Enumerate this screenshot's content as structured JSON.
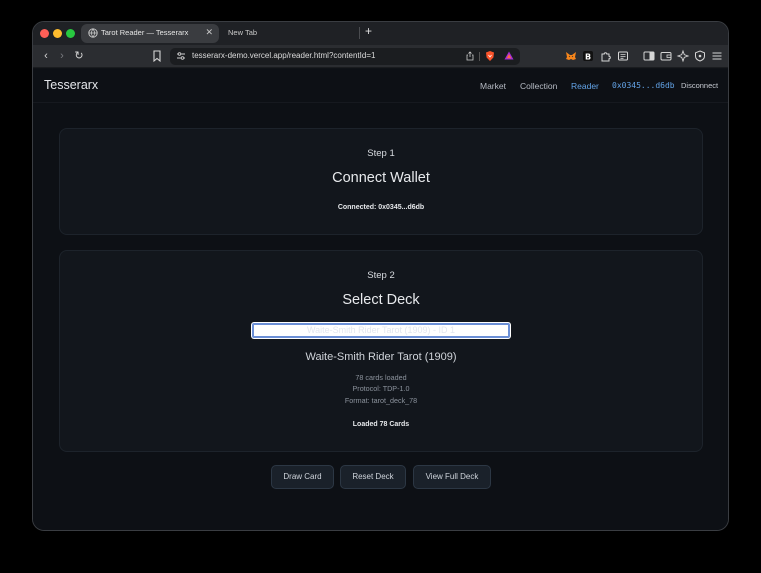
{
  "browser": {
    "active_tab_title": "Tarot Reader — Tesserarx",
    "new_tab_title": "New Tab",
    "url": "tesserarx-demo.vercel.app/reader.html?contentId=1"
  },
  "app": {
    "brand": "Tesserarx",
    "nav": [
      "Market",
      "Collection",
      "Reader"
    ],
    "active_nav": "Reader",
    "wallet_address": "0x0345...d6db",
    "disconnect_label": "Disconnect",
    "accent_color": "#63a4e8"
  },
  "step1": {
    "step_label": "Step 1",
    "title": "Connect Wallet",
    "status": "Connected: 0x0345...d6db"
  },
  "step2": {
    "step_label": "Step 2",
    "title": "Select Deck",
    "select_value": "Waite-Smith Rider Tarot (1909) - ID 1",
    "deck_name": "Waite-Smith Rider Tarot (1909)",
    "cards_loaded": "78 cards loaded",
    "protocol": "Protocol: TDP-1.0",
    "format": "Format: tarot_deck_78",
    "status": "Loaded 78 Cards"
  },
  "actions": {
    "draw": "Draw Card",
    "reset": "Reset Deck",
    "view": "View Full Deck"
  }
}
